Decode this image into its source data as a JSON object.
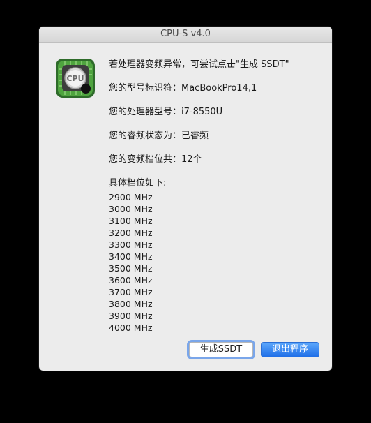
{
  "window": {
    "title": "CPU-S v4.0"
  },
  "app_icon": {
    "name": "cpu-icon",
    "label": "CPU"
  },
  "info": {
    "line1": "若处理器变频异常，可尝试点击\"生成 SSDT\"",
    "line2": "您的型号标识符：MacBookPro14,1",
    "line3": "您的处理器型号：i7-8550U",
    "line4": "您的睿频状态为：已睿频",
    "line5": "您的变频档位共：12个",
    "list_header": "具体档位如下:"
  },
  "frequencies": [
    "2900 MHz",
    "3000 MHz",
    "3100 MHz",
    "3200 MHz",
    "3300 MHz",
    "3400 MHz",
    "3500 MHz",
    "3600 MHz",
    "3700 MHz",
    "3800 MHz",
    "3900 MHz",
    "4000 MHz"
  ],
  "buttons": {
    "generate_ssdt": "生成SSDT",
    "quit": "退出程序"
  }
}
